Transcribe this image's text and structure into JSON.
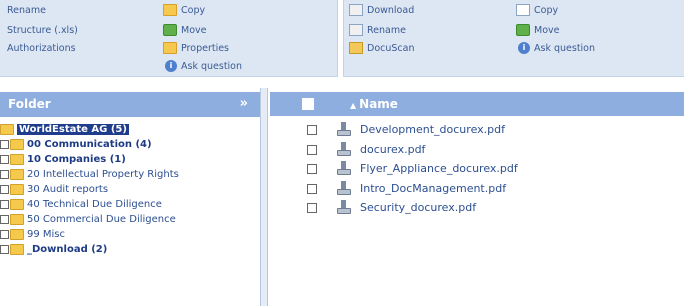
{
  "toolbar": {
    "folder_actions_col1": [
      "Rename",
      "Structure (.xls)",
      "Authorizations"
    ],
    "folder_actions_col2": [
      "Copy",
      "Move",
      "Properties",
      "Ask question"
    ],
    "file_actions_col1": [
      "Download",
      "Rename",
      "DocuScan"
    ],
    "file_actions_col2": [
      "Copy",
      "Move",
      "Ask question"
    ]
  },
  "folder_panel": {
    "title": "Folder",
    "collapse_glyph": "»",
    "root": "WorldEstate AG (5)",
    "items": [
      {
        "label": "00 Communication (4)",
        "bold": true
      },
      {
        "label": "10 Companies (1)",
        "bold": true
      },
      {
        "label": "20 Intellectual Property Rights",
        "bold": false
      },
      {
        "label": "30 Audit reports",
        "bold": false
      },
      {
        "label": "40 Technical Due Diligence",
        "bold": false
      },
      {
        "label": "50 Commercial Due Diligence",
        "bold": false
      },
      {
        "label": "99 Misc",
        "bold": false
      },
      {
        "label": "_Download (2)",
        "bold": true
      }
    ]
  },
  "file_list": {
    "column_name": "Name",
    "sort_glyph": "▲",
    "files": [
      "Development_docurex.pdf",
      "docurex.pdf",
      "Flyer_Appliance_docurex.pdf",
      "Intro_DocManagement.pdf",
      "Security_docurex.pdf"
    ]
  },
  "icons": {
    "info": "i"
  }
}
